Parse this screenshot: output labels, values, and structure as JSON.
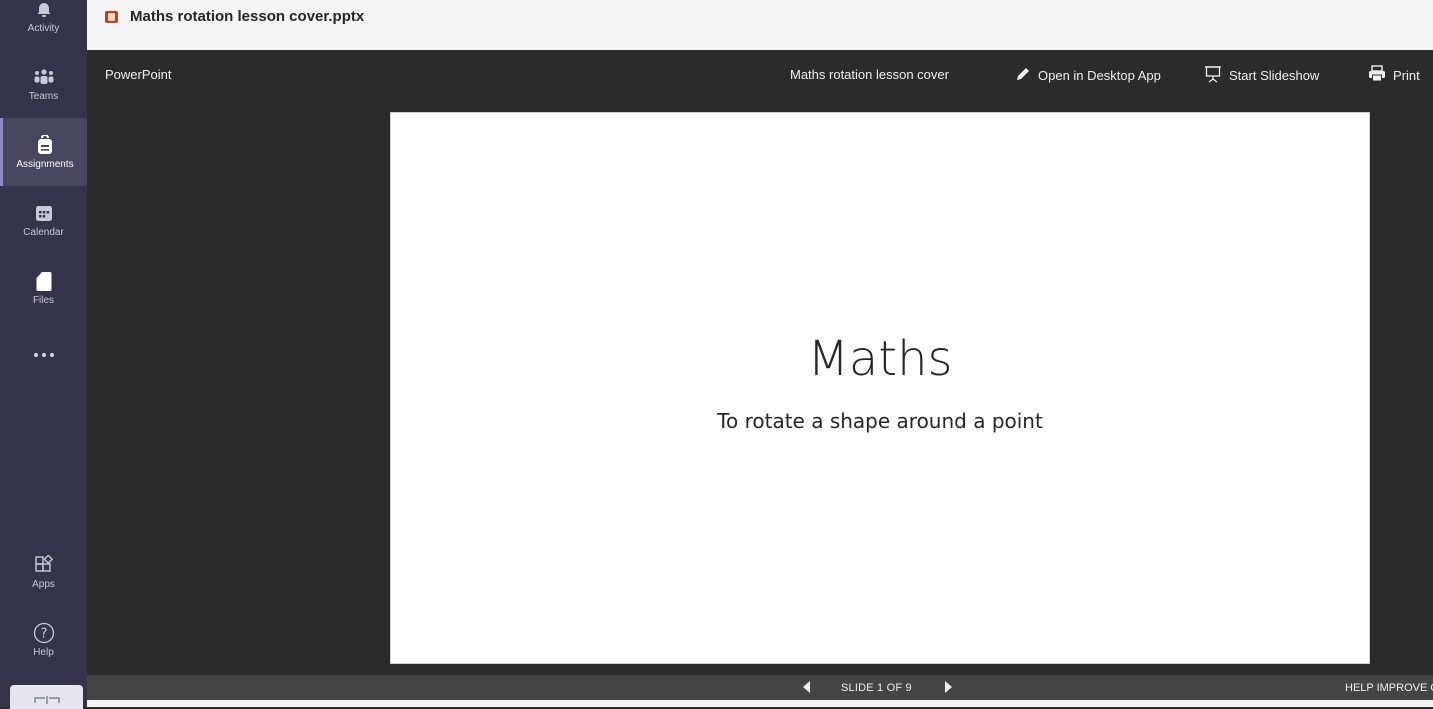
{
  "rail": {
    "items": [
      {
        "label": "Activity",
        "icon": "bell-icon"
      },
      {
        "label": "Teams",
        "icon": "teams-icon"
      },
      {
        "label": "Assignments",
        "icon": "assignments-icon",
        "active": true
      },
      {
        "label": "Calendar",
        "icon": "calendar-icon"
      },
      {
        "label": "Files",
        "icon": "file-icon"
      },
      {
        "label": "...",
        "icon": "more-icon"
      }
    ],
    "bottom_items": [
      {
        "label": "Apps",
        "icon": "apps-icon"
      },
      {
        "label": "Help",
        "icon": "help-icon"
      }
    ]
  },
  "header": {
    "file_name": "Maths rotation lesson cover.pptx",
    "file_icon": "powerpoint-file-icon"
  },
  "viewer": {
    "app_name": "PowerPoint",
    "document_title": "Maths rotation lesson cover",
    "commands": {
      "open_desktop": "Open in Desktop App",
      "start_slideshow": "Start Slideshow",
      "print": "Print"
    }
  },
  "slide": {
    "title": "Maths",
    "subtitle": "To rotate a shape around a point"
  },
  "status": {
    "slide_counter": "SLIDE 1 OF 9",
    "help_link": "HELP IMPROVE OFFICE"
  },
  "colors": {
    "rail_bg": "#33344a",
    "rail_active": "#46475e",
    "viewer_bg": "#2b2b2b",
    "statusbar_bg": "#444444",
    "powerpoint_red": "#c43e1c"
  }
}
